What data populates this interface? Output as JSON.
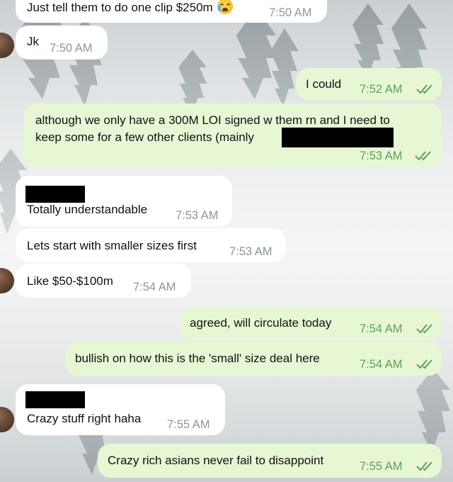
{
  "messages": [
    {
      "side": "in",
      "text": "Just tell them to do one clip $250m",
      "time": "7:50 AM",
      "emoji": "loudly-crying-face"
    },
    {
      "side": "in",
      "text": "Jk",
      "time": "7:50 AM"
    },
    {
      "side": "out",
      "text": "I could",
      "time": "7:52 AM",
      "status": "read"
    },
    {
      "side": "out",
      "text_line1": "although we only have a 300M LOI signed w them rn and I need to",
      "text_line2": "keep some for a few other clients (mainly",
      "redacted": true,
      "time": "7:53 AM",
      "status": "read"
    },
    {
      "side": "in",
      "sender_redacted": true,
      "text": "Totally understandable",
      "time": "7:53 AM"
    },
    {
      "side": "in",
      "text": "Lets start with smaller sizes first",
      "time": "7:53 AM"
    },
    {
      "side": "in",
      "text": "Like $50-$100m",
      "time": "7:54 AM"
    },
    {
      "side": "out",
      "text": "agreed, will circulate today",
      "time": "7:54 AM",
      "status": "read"
    },
    {
      "side": "out",
      "text": "bullish on how this is the 'small' size deal here",
      "time": "7:54 AM",
      "status": "read"
    },
    {
      "side": "in",
      "sender_redacted": true,
      "text": "Crazy stuff right haha",
      "time": "7:55 AM"
    },
    {
      "side": "out",
      "text": "Crazy rich asians never fail to disappoint",
      "time": "7:55 AM",
      "status": "read"
    }
  ],
  "icons": {
    "read_receipt": "double-check-icon",
    "emoji": "loudly-crying-face-emoji"
  },
  "colors": {
    "incoming": "#ffffff",
    "outgoing": "#e7f7d4",
    "outgoing_time": "#5fa05a",
    "incoming_time": "#8e959c"
  }
}
